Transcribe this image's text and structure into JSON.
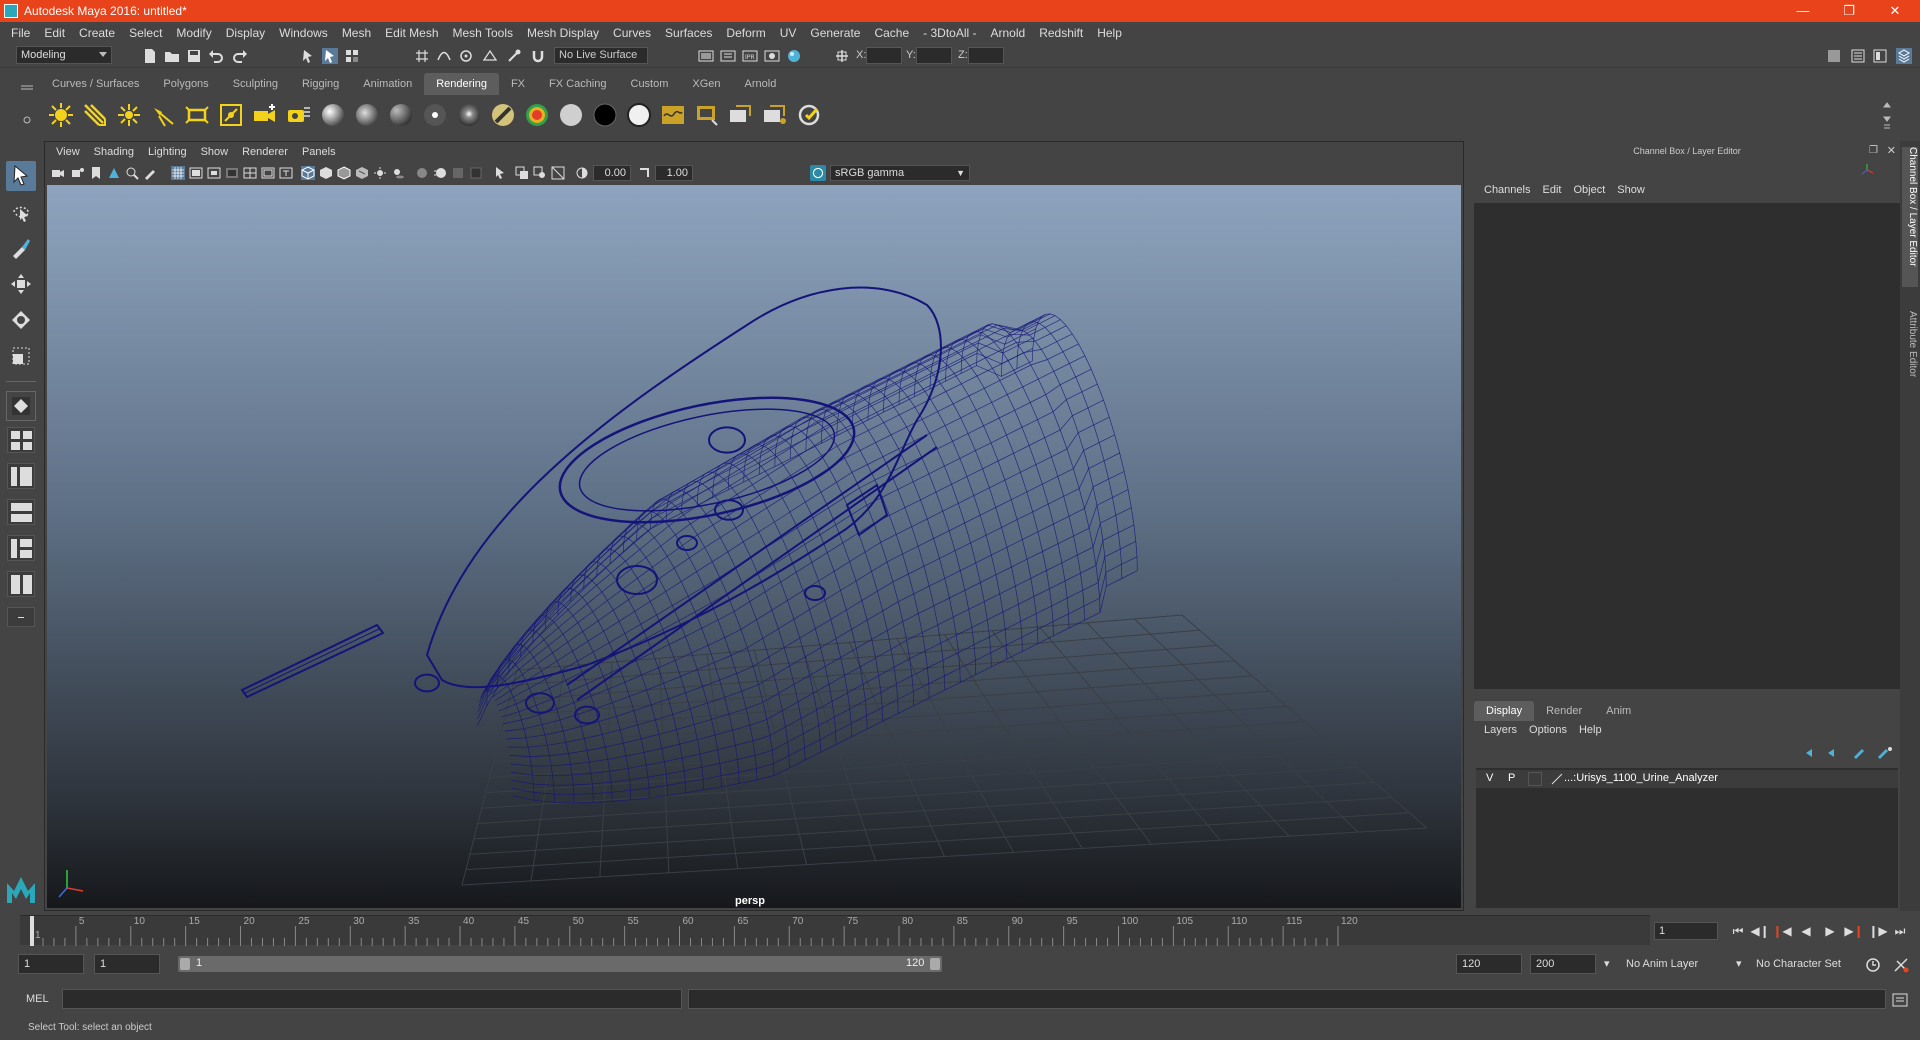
{
  "window": {
    "title": "Autodesk Maya 2016: untitled*"
  },
  "menubar": [
    "File",
    "Edit",
    "Create",
    "Select",
    "Modify",
    "Display",
    "Windows",
    "Mesh",
    "Edit Mesh",
    "Mesh Tools",
    "Mesh Display",
    "Curves",
    "Surfaces",
    "Deform",
    "UV",
    "Generate",
    "Cache",
    "- 3DtoAll -",
    "Arnold",
    "Redshift",
    "Help"
  ],
  "statusline": {
    "mode": "Modeling",
    "live_surface": "No Live Surface",
    "x_label": "X:",
    "y_label": "Y:",
    "z_label": "Z:"
  },
  "shelf_tabs": [
    "Curves / Surfaces",
    "Polygons",
    "Sculpting",
    "Rigging",
    "Animation",
    "Rendering",
    "FX",
    "FX Caching",
    "Custom",
    "XGen",
    "Arnold"
  ],
  "shelf_active": "Rendering",
  "viewport": {
    "menu": [
      "View",
      "Shading",
      "Lighting",
      "Show",
      "Renderer",
      "Panels"
    ],
    "exposure": "0.00",
    "gamma": "1.00",
    "color_management": "sRGB gamma",
    "camera": "persp"
  },
  "channelbox": {
    "title": "Channel Box / Layer Editor",
    "menu": [
      "Channels",
      "Edit",
      "Object",
      "Show"
    ],
    "layer_tabs": [
      "Display",
      "Render",
      "Anim"
    ],
    "layer_menu": [
      "Layers",
      "Options",
      "Help"
    ],
    "layers": [
      {
        "v": "V",
        "p": "P",
        "name": "...:Urisys_1100_Urine_Analyzer"
      }
    ]
  },
  "side_tabs": [
    "Channel Box / Layer Editor",
    "Attribute Editor"
  ],
  "timeslider": {
    "ticks": [
      "1",
      "5",
      "10",
      "15",
      "20",
      "25",
      "30",
      "35",
      "40",
      "45",
      "50",
      "55",
      "60",
      "65",
      "70",
      "75",
      "80",
      "85",
      "90",
      "95",
      "100",
      "105",
      "110",
      "115",
      "120"
    ],
    "current_frame": "1"
  },
  "range": {
    "start": "1",
    "anim_start": "1",
    "slider_start": "1",
    "slider_end": "120",
    "end": "120",
    "anim_end": "200",
    "anim_layer": "No Anim Layer",
    "char_set": "No Character Set"
  },
  "cmd": {
    "mel": "MEL"
  },
  "help": "Select Tool: select an object",
  "colors": {
    "titlebar": "#e8431a",
    "wireframe": "#14147a",
    "accent": "#5a7a9a"
  }
}
